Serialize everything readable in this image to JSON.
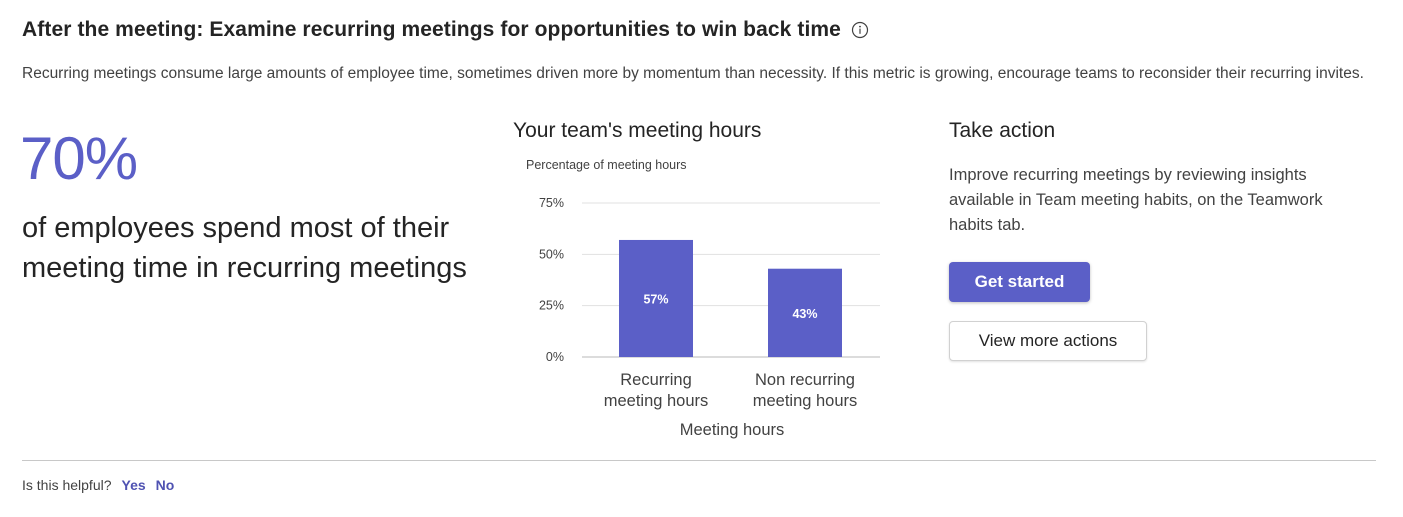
{
  "header": {
    "title": "After the meeting: Examine recurring meetings for opportunities to win back time",
    "description": "Recurring meetings consume large amounts of employee time, sometimes driven more by momentum than necessity. If this metric is growing, encourage teams to reconsider their recurring invites."
  },
  "stat": {
    "value": "70%",
    "text": "of employees spend most of their meeting time in recurring meetings"
  },
  "chart_data": {
    "type": "bar",
    "title": "Your team's meeting hours",
    "ylabel": "Percentage of meeting hours",
    "xlabel": "Meeting hours",
    "categories": [
      "Recurring meeting hours",
      "Non recurring meeting hours"
    ],
    "category_lines": [
      [
        "Recurring",
        "meeting hours"
      ],
      [
        "Non recurring",
        "meeting hours"
      ]
    ],
    "values": [
      57,
      43
    ],
    "data_labels": [
      "57%",
      "43%"
    ],
    "yticks": [
      "0%",
      "25%",
      "50%",
      "75%"
    ],
    "ytick_values": [
      0,
      25,
      50,
      75
    ],
    "ylim": [
      0,
      75
    ],
    "grid": true,
    "bar_color": "#5b5fc7"
  },
  "action": {
    "title": "Take action",
    "text": "Improve recurring meetings by reviewing insights available in Team meeting habits, on the Teamwork habits tab.",
    "primary_label": "Get started",
    "secondary_label": "View more actions"
  },
  "feedback": {
    "question": "Is this helpful?",
    "yes": "Yes",
    "no": "No"
  },
  "colors": {
    "accent": "#5b5fc7",
    "link": "#4f52b2",
    "gridline": "#e1e1e1",
    "divider": "#c8c8c8"
  }
}
